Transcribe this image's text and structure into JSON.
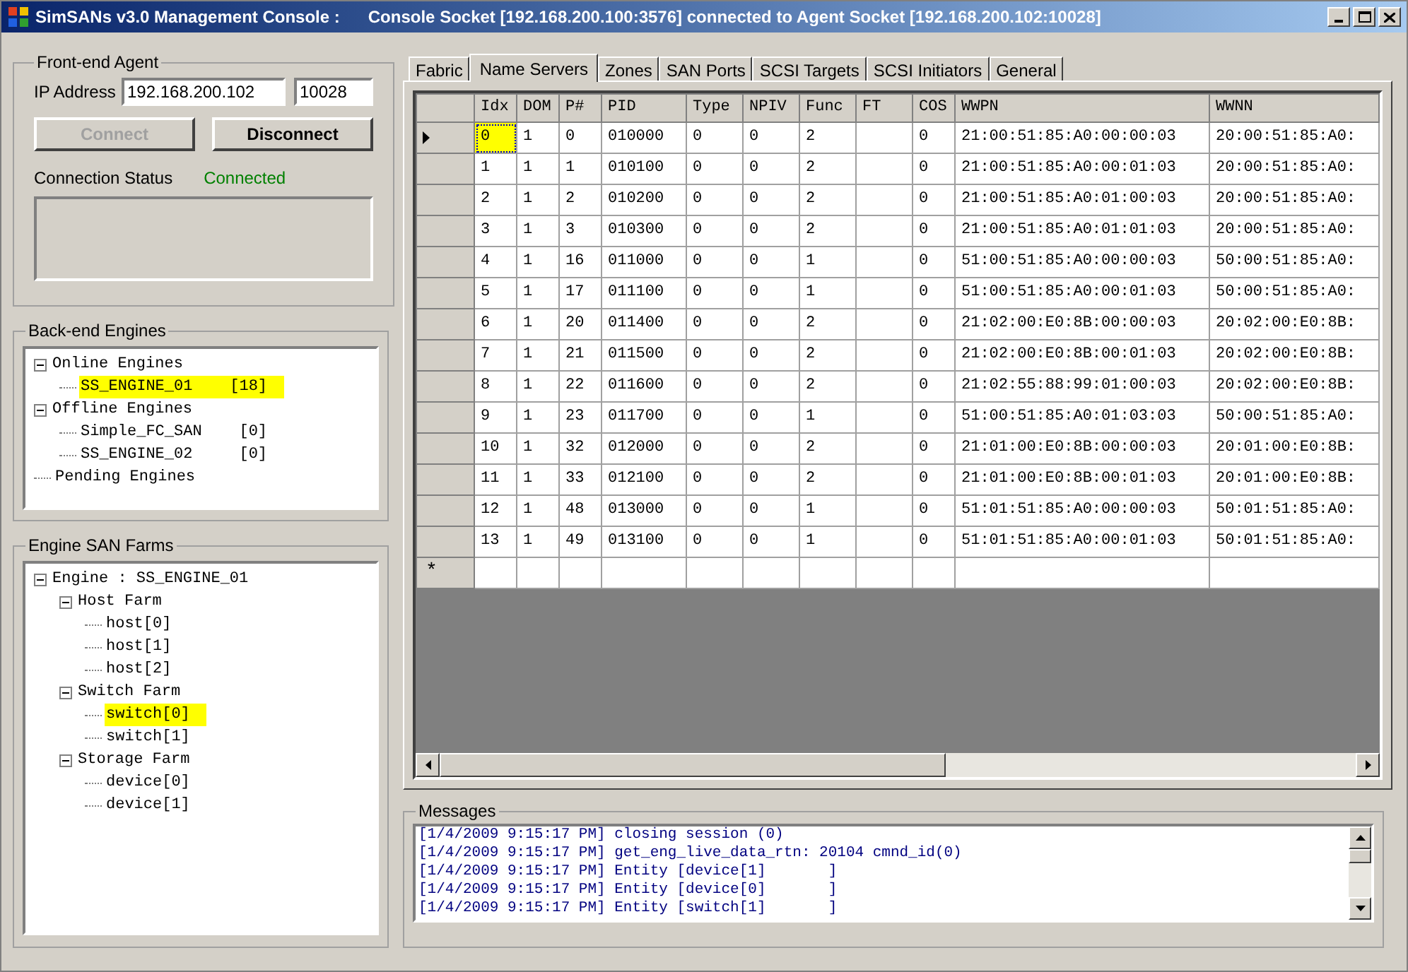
{
  "window": {
    "title_app": "SimSANs v3.0 Management Console :",
    "title_status": "Console Socket [192.168.200.100:3576] connected to Agent Socket [192.168.200.102:10028]"
  },
  "front_end_agent": {
    "title": "Front-end Agent",
    "ip_label": "IP Address",
    "ip_value": "192.168.200.102",
    "port_value": "10028",
    "buttons": [
      {
        "label": "Connect",
        "disabled": true
      },
      {
        "label": "Disconnect",
        "disabled": false
      }
    ],
    "status_label": "Connection Status",
    "status_value": "Connected"
  },
  "back_end_engines": {
    "title": "Back-end Engines",
    "tree": [
      {
        "label": "Online Engines",
        "expanded": true,
        "selected": false,
        "children": [
          {
            "label": "SS_ENGINE_01    [18]",
            "selected": true
          }
        ]
      },
      {
        "label": "Offline Engines",
        "expanded": true,
        "selected": false,
        "children": [
          {
            "label": "Simple_FC_SAN    [0]",
            "selected": false
          },
          {
            "label": "SS_ENGINE_02     [0]",
            "selected": false
          }
        ]
      },
      {
        "label": "Pending Engines",
        "selected": false
      }
    ]
  },
  "engine_san_farms": {
    "title": "Engine SAN Farms",
    "tree": [
      {
        "label": "Engine : SS_ENGINE_01",
        "expanded": true,
        "selected": false,
        "children": [
          {
            "label": "Host Farm",
            "expanded": true,
            "selected": false,
            "children": [
              {
                "label": "host[0]",
                "selected": false
              },
              {
                "label": "host[1]",
                "selected": false
              },
              {
                "label": "host[2]",
                "selected": false
              }
            ]
          },
          {
            "label": "Switch Farm",
            "expanded": true,
            "selected": false,
            "children": [
              {
                "label": "switch[0]",
                "selected": true
              },
              {
                "label": "switch[1]",
                "selected": false
              }
            ]
          },
          {
            "label": "Storage Farm",
            "expanded": true,
            "selected": false,
            "children": [
              {
                "label": "device[0]",
                "selected": false
              },
              {
                "label": "device[1]",
                "selected": false
              }
            ]
          }
        ]
      }
    ]
  },
  "tabs": [
    {
      "label": "Fabric",
      "selected": false
    },
    {
      "label": "Name Servers",
      "selected": true
    },
    {
      "label": "Zones",
      "selected": false
    },
    {
      "label": "SAN Ports",
      "selected": false
    },
    {
      "label": "SCSI Targets",
      "selected": false
    },
    {
      "label": "SCSI Initiators",
      "selected": false
    },
    {
      "label": "General",
      "selected": false
    }
  ],
  "table": {
    "columns": [
      "Idx",
      "DOM",
      "P#",
      "PID",
      "Type",
      "NPIV",
      "Func",
      "FT",
      "COS",
      "WWPN",
      "WWNN"
    ],
    "rows": [
      {
        "current": true,
        "cells": [
          "0",
          "1",
          "0",
          "010000",
          "0",
          "0",
          "2",
          "",
          "0",
          "21:00:51:85:A0:00:00:03",
          "20:00:51:85:A0:"
        ]
      },
      {
        "current": false,
        "cells": [
          "1",
          "1",
          "1",
          "010100",
          "0",
          "0",
          "2",
          "",
          "0",
          "21:00:51:85:A0:00:01:03",
          "20:00:51:85:A0:"
        ]
      },
      {
        "current": false,
        "cells": [
          "2",
          "1",
          "2",
          "010200",
          "0",
          "0",
          "2",
          "",
          "0",
          "21:00:51:85:A0:01:00:03",
          "20:00:51:85:A0:"
        ]
      },
      {
        "current": false,
        "cells": [
          "3",
          "1",
          "3",
          "010300",
          "0",
          "0",
          "2",
          "",
          "0",
          "21:00:51:85:A0:01:01:03",
          "20:00:51:85:A0:"
        ]
      },
      {
        "current": false,
        "cells": [
          "4",
          "1",
          "16",
          "011000",
          "0",
          "0",
          "1",
          "",
          "0",
          "51:00:51:85:A0:00:00:03",
          "50:00:51:85:A0:"
        ]
      },
      {
        "current": false,
        "cells": [
          "5",
          "1",
          "17",
          "011100",
          "0",
          "0",
          "1",
          "",
          "0",
          "51:00:51:85:A0:00:01:03",
          "50:00:51:85:A0:"
        ]
      },
      {
        "current": false,
        "cells": [
          "6",
          "1",
          "20",
          "011400",
          "0",
          "0",
          "2",
          "",
          "0",
          "21:02:00:E0:8B:00:00:03",
          "20:02:00:E0:8B:"
        ]
      },
      {
        "current": false,
        "cells": [
          "7",
          "1",
          "21",
          "011500",
          "0",
          "0",
          "2",
          "",
          "0",
          "21:02:00:E0:8B:00:01:03",
          "20:02:00:E0:8B:"
        ]
      },
      {
        "current": false,
        "cells": [
          "8",
          "1",
          "22",
          "011600",
          "0",
          "0",
          "2",
          "",
          "0",
          "21:02:55:88:99:01:00:03",
          "20:02:00:E0:8B:"
        ]
      },
      {
        "current": false,
        "cells": [
          "9",
          "1",
          "23",
          "011700",
          "0",
          "0",
          "1",
          "",
          "0",
          "51:00:51:85:A0:01:03:03",
          "50:00:51:85:A0:"
        ]
      },
      {
        "current": false,
        "cells": [
          "10",
          "1",
          "32",
          "012000",
          "0",
          "0",
          "2",
          "",
          "0",
          "21:01:00:E0:8B:00:00:03",
          "20:01:00:E0:8B:"
        ]
      },
      {
        "current": false,
        "cells": [
          "11",
          "1",
          "33",
          "012100",
          "0",
          "0",
          "2",
          "",
          "0",
          "21:01:00:E0:8B:00:01:03",
          "20:01:00:E0:8B:"
        ]
      },
      {
        "current": false,
        "cells": [
          "12",
          "1",
          "48",
          "013000",
          "0",
          "0",
          "1",
          "",
          "0",
          "51:01:51:85:A0:00:00:03",
          "50:01:51:85:A0:"
        ]
      },
      {
        "current": false,
        "cells": [
          "13",
          "1",
          "49",
          "013100",
          "0",
          "0",
          "1",
          "",
          "0",
          "51:01:51:85:A0:00:01:03",
          "50:01:51:85:A0:"
        ]
      }
    ],
    "new_row_marker": "*"
  },
  "messages": {
    "title": "Messages",
    "lines": [
      "[1/4/2009 9:15:17 PM] closing session (0)",
      "[1/4/2009 9:15:17 PM] get_eng_live_data_rtn: 20104 cmnd_id(0)",
      "[1/4/2009 9:15:17 PM] Entity [device[1]       ]",
      "[1/4/2009 9:15:17 PM] Entity [device[0]       ]",
      "[1/4/2009 9:15:17 PM] Entity [switch[1]       ]"
    ]
  }
}
